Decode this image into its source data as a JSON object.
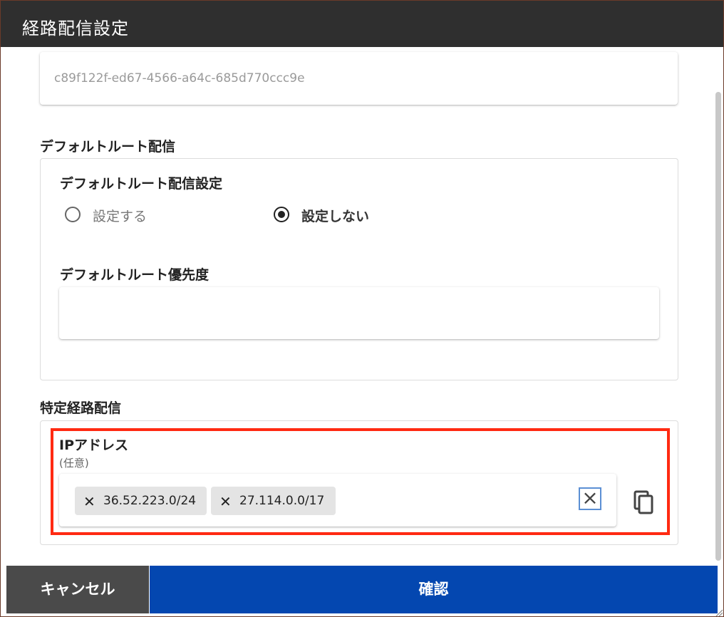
{
  "window": {
    "title": "経路配信設定"
  },
  "id_field": {
    "value": "c89f122f-ed67-4566-a64c-685d770ccc9e"
  },
  "default_route": {
    "section_label": "デフォルトルート配信",
    "setting_label": "デフォルトルート配信設定",
    "options": [
      {
        "label": "設定する",
        "checked": false
      },
      {
        "label": "設定しない",
        "checked": true
      }
    ],
    "priority_label": "デフォルトルート優先度",
    "priority_value": ""
  },
  "specific_route": {
    "section_label": "特定経路配信",
    "ip_label": "IPアドレス",
    "ip_hint": "(任意)",
    "chips": [
      "36.52.223.0/24",
      "27.114.0.0/17"
    ],
    "clear_icon": "close-icon",
    "copy_icon": "copy-icon"
  },
  "footer": {
    "cancel_label": "キャンセル",
    "confirm_label": "確認"
  },
  "colors": {
    "titlebar": "#2f2f2f",
    "confirm": "#0447b0",
    "cancel": "#4a4a4a",
    "highlight": "#ff2a12"
  }
}
